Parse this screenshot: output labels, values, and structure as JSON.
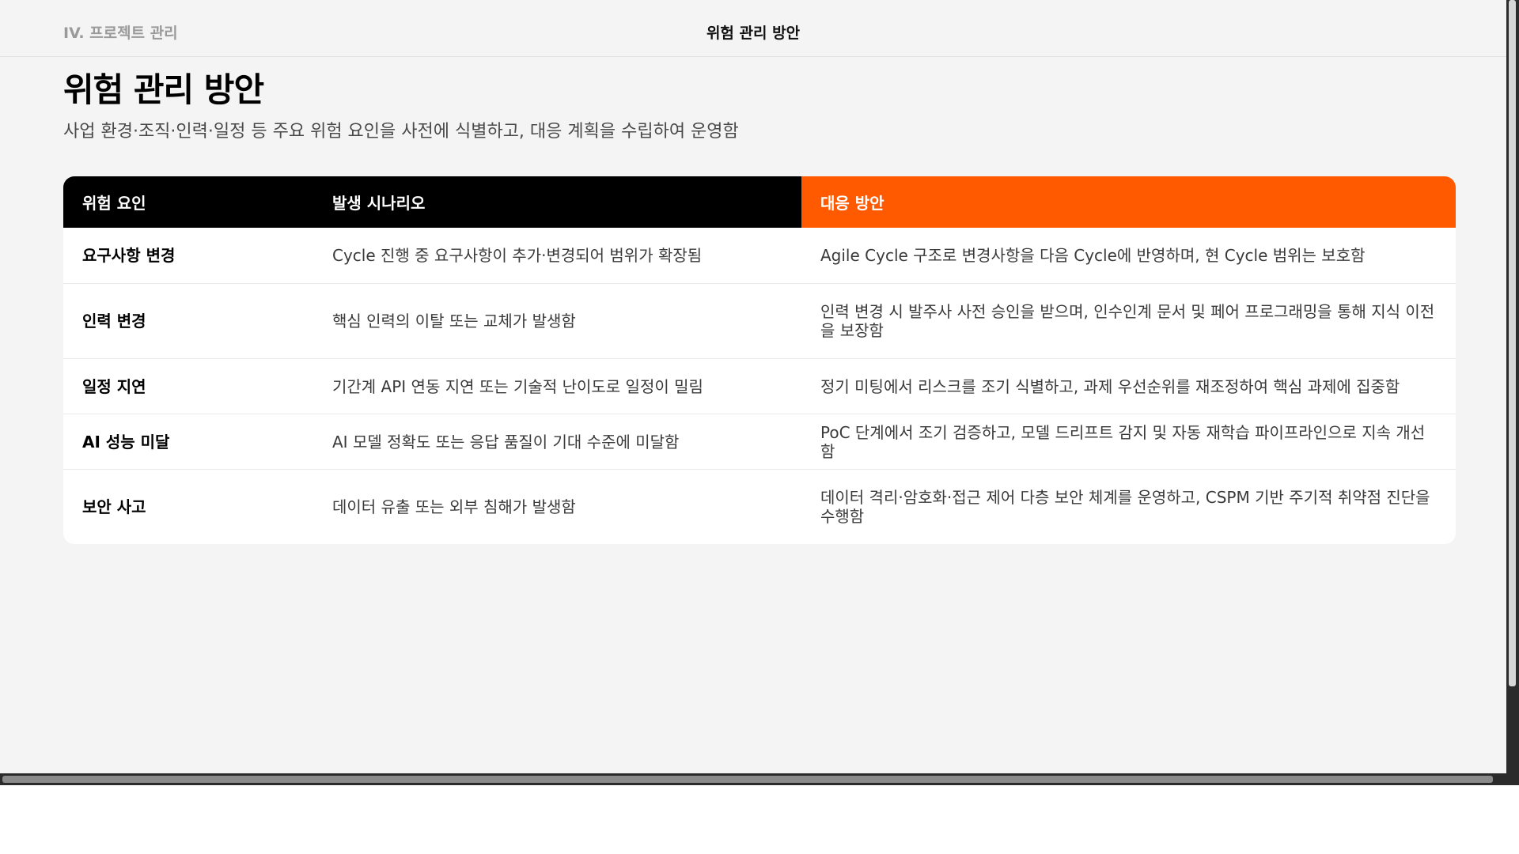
{
  "header": {
    "breadcrumb": "IV. 프로젝트 관리",
    "title": "위험 관리 방안"
  },
  "page": {
    "title": "위험 관리 방안",
    "subtitle": "사업 환경·조직·인력·일정 등 주요 위험 요인을 사전에 식별하고, 대응 계획을 수립하여 운영함"
  },
  "table": {
    "columns": [
      "위험 요인",
      "발생 시나리오",
      "대응 방안"
    ],
    "rows": [
      {
        "factor": "요구사항 변경",
        "scenario": "Cycle 진행 중 요구사항이 추가·변경되어 범위가 확장됨",
        "response": "Agile Cycle 구조로 변경사항을 다음 Cycle에 반영하며, 현 Cycle 범위는 보호함"
      },
      {
        "factor": "인력 변경",
        "scenario": "핵심 인력의 이탈 또는 교체가 발생함",
        "response": "인력 변경 시 발주사 사전 승인을 받으며, 인수인계 문서 및 페어 프로그래밍을 통해 지식 이전을 보장함"
      },
      {
        "factor": "일정 지연",
        "scenario": "기간계 API 연동 지연 또는 기술적 난이도로 일정이 밀림",
        "response": "정기 미팅에서 리스크를 조기 식별하고, 과제 우선순위를 재조정하여 핵심 과제에 집중함"
      },
      {
        "factor": "AI 성능 미달",
        "scenario": "AI 모델 정확도 또는 응답 품질이 기대 수준에 미달함",
        "response": "PoC 단계에서 조기 검증하고, 모델 드리프트 감지 및 자동 재학습 파이프라인으로 지속 개선함"
      },
      {
        "factor": "보안 사고",
        "scenario": "데이터 유출 또는 외부 침해가 발생함",
        "response": "데이터 격리·암호화·접근 제어 다층 보안 체계를 운영하고, CSPM 기반 주기적 취약점 진단을 수행함"
      }
    ]
  },
  "colors": {
    "header_dark": "#000000",
    "header_accent": "#ff5a00",
    "background": "#f4f4f4"
  }
}
